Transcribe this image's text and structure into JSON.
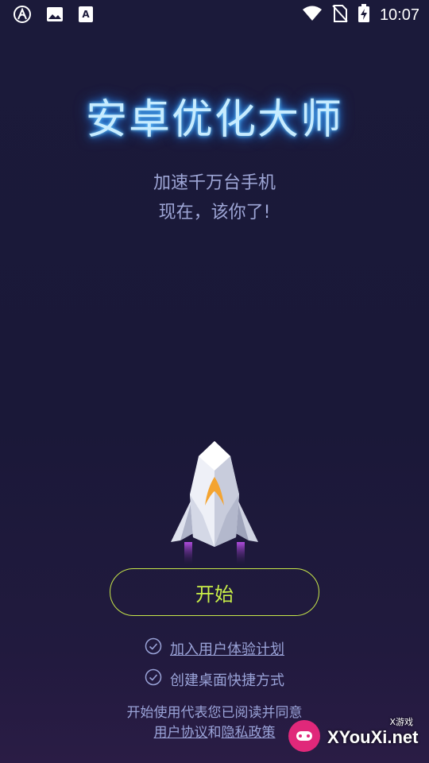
{
  "status_bar": {
    "time": "10:07",
    "left_icons": [
      "arc-app-icon",
      "image-icon",
      "font-app-icon"
    ],
    "right_icons": [
      "wifi-icon",
      "no-sim-icon",
      "battery-charging-icon"
    ]
  },
  "app": {
    "title": "安卓优化大师",
    "subtitle_line1": "加速千万台手机",
    "subtitle_line2": "现在，该你了!"
  },
  "start_button": {
    "label": "开始"
  },
  "options": [
    {
      "label": "加入用户体验计划",
      "checked": true,
      "link": true
    },
    {
      "label": "创建桌面快捷方式",
      "checked": true,
      "link": false
    }
  ],
  "agreement": {
    "line1": "开始使用代表您已阅读并同意",
    "user_agreement": "用户协议",
    "and": "和",
    "privacy_policy": "隐私政策"
  },
  "watermark": {
    "small": "X游戏",
    "main": "XYouXi.net"
  },
  "colors": {
    "accent": "#c9ef48",
    "title_glow": "#2f9dff",
    "text_muted": "#9aa3d8"
  }
}
